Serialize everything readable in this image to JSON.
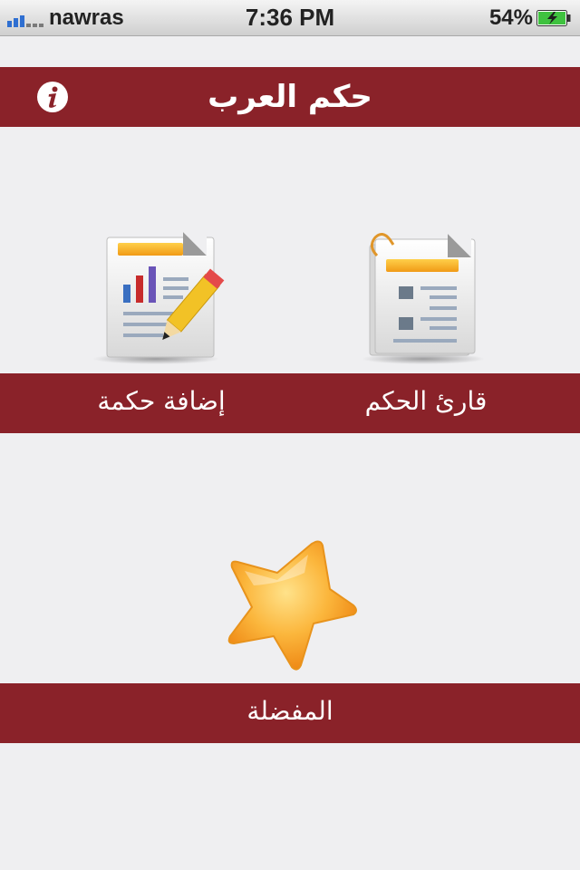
{
  "status_bar": {
    "carrier": "nawras",
    "time": "7:36 PM",
    "battery_percent": "54%",
    "battery_level": 0.54,
    "signal_icon": "signal-bars-icon",
    "battery_icon": "battery-charging-icon"
  },
  "header": {
    "title": "حكم العرب",
    "info_icon": "info-icon"
  },
  "menu": {
    "add_wisdom": {
      "label": "إضافة حكمة",
      "icon": "document-chart-pencil-icon"
    },
    "wisdom_reader": {
      "label": "قارئ الحكم",
      "icon": "document-clip-icon"
    },
    "favorites": {
      "label": "المفضلة",
      "icon": "star-icon"
    }
  },
  "colors": {
    "band": "#8a2229",
    "background": "#efeff1"
  }
}
